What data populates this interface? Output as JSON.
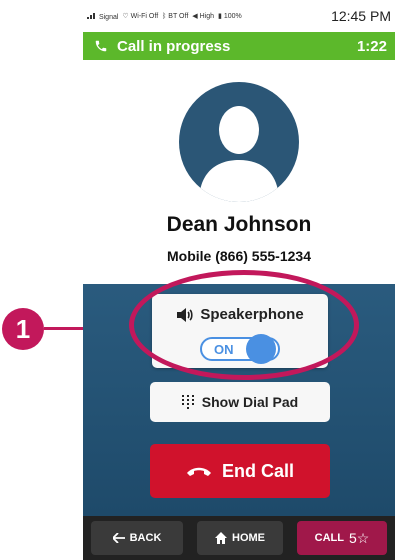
{
  "status_bar": {
    "signal": "Signal",
    "wifi": "Wi-Fi Off",
    "bluetooth": "BT Off",
    "volume": "High",
    "battery": "100%",
    "time": "12:45 PM"
  },
  "call_header": {
    "title": "Call in progress",
    "timer": "1:22",
    "color": "#5cb82b"
  },
  "contact": {
    "name": "Dean Johnson",
    "number": "Mobile (866) 555-1234",
    "avatar_icon": "person-silhouette-icon"
  },
  "speakerphone": {
    "label": "Speakerphone",
    "toggle_state": "ON",
    "icon": "speaker-icon"
  },
  "dialpad": {
    "label": "Show Dial Pad",
    "icon": "dialpad-icon"
  },
  "end_call": {
    "label": "End Call",
    "icon": "hangup-icon",
    "color": "#d0122c"
  },
  "bottom_nav": {
    "back": "BACK",
    "home": "HOME",
    "call": "CALL",
    "call_superscript": "5☆"
  },
  "annotation": {
    "number": "1",
    "color": "#c2185b"
  }
}
